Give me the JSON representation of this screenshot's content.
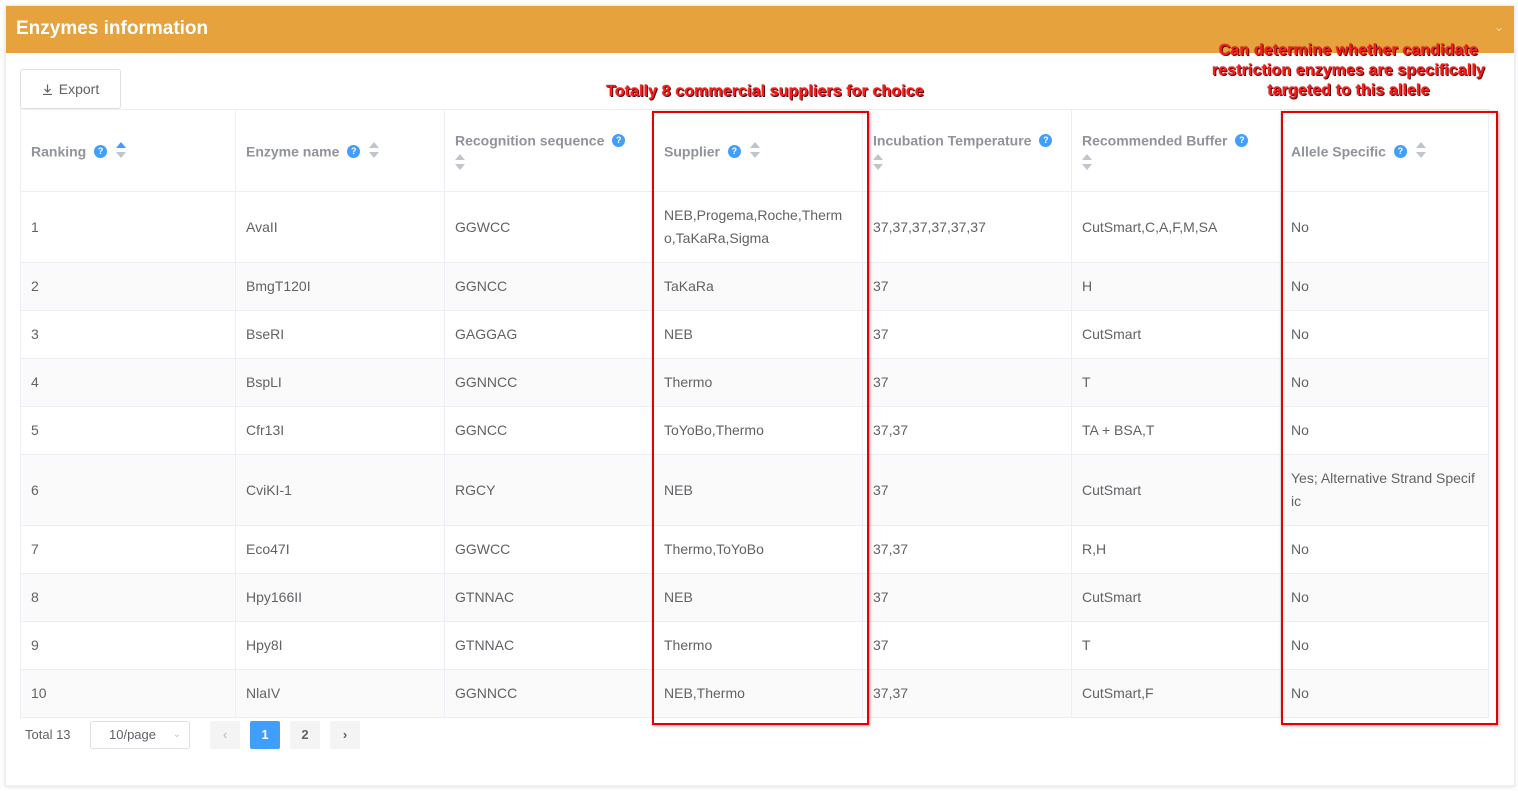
{
  "panel": {
    "title": "Enzymes information"
  },
  "toolbar": {
    "export_label": "Export"
  },
  "table": {
    "columns": [
      "Ranking",
      "Enzyme name",
      "Recognition sequence",
      "Supplier",
      "Incubation Temperature",
      "Recommended Buffer",
      "Allele Specific"
    ],
    "rows": [
      [
        "1",
        "AvaII",
        "GGWCC",
        "NEB,Progema,Roche,Thermo,TaKaRa,Sigma",
        "37,37,37,37,37,37",
        "CutSmart,C,A,F,M,SA",
        "No"
      ],
      [
        "2",
        "BmgT120I",
        "GGNCC",
        "TaKaRa",
        "37",
        "H",
        "No"
      ],
      [
        "3",
        "BseRI",
        "GAGGAG",
        "NEB",
        "37",
        "CutSmart",
        "No"
      ],
      [
        "4",
        "BspLI",
        "GGNNCC",
        "Thermo",
        "37",
        "T",
        "No"
      ],
      [
        "5",
        "Cfr13I",
        "GGNCC",
        "ToYoBo,Thermo",
        "37,37",
        "TA + BSA,T",
        "No"
      ],
      [
        "6",
        "CviKI-1",
        "RGCY",
        "NEB",
        "37",
        "CutSmart",
        "Yes; Alternative Strand Specific"
      ],
      [
        "7",
        "Eco47I",
        "GGWCC",
        "Thermo,ToYoBo",
        "37,37",
        "R,H",
        "No"
      ],
      [
        "8",
        "Hpy166II",
        "GTNNAC",
        "NEB",
        "37",
        "CutSmart",
        "No"
      ],
      [
        "9",
        "Hpy8I",
        "GTNNAC",
        "Thermo",
        "37",
        "T",
        "No"
      ],
      [
        "10",
        "NlaIV",
        "GGNNCC",
        "NEB,Thermo",
        "37,37",
        "CutSmart,F",
        "No"
      ]
    ]
  },
  "pagination": {
    "total": "Total 13",
    "page_size": "10/page",
    "pages": [
      "1",
      "2"
    ],
    "current_page": "1",
    "prev_icon": "chevron-left-icon",
    "next_icon": "chevron-right-icon"
  },
  "annotations": {
    "suppliers": "Totally 8 commercial suppliers for choice",
    "allele": "Can determine whether candidate restriction enzymes are specifically targeted to this allele"
  },
  "colors": {
    "header_bg": "#e6a23c",
    "accent": "#409eff",
    "annotation": "#e60000"
  }
}
